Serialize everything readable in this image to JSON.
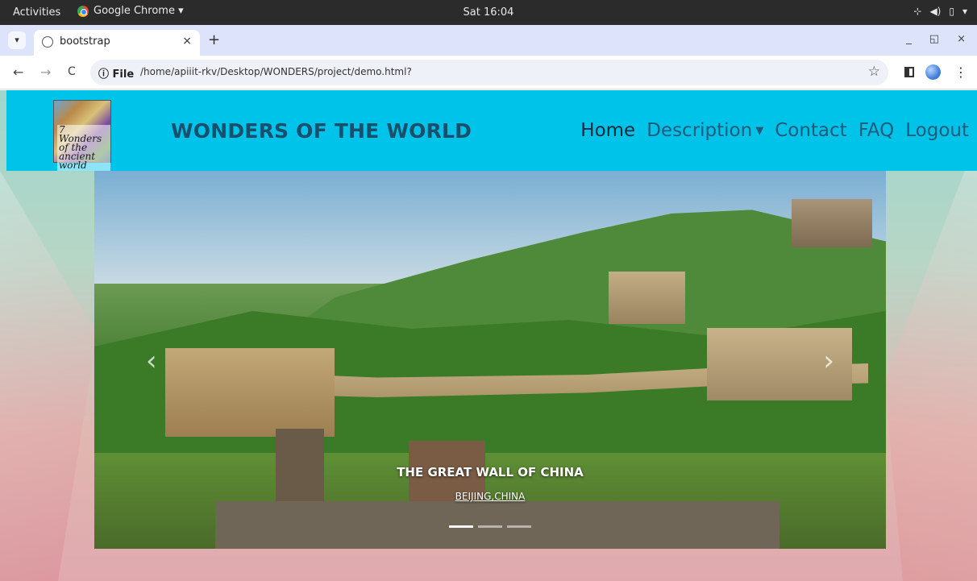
{
  "system_bar": {
    "activities_label": "Activities",
    "app_name": "Google Chrome ▾",
    "clock": "Sat 16:04",
    "tray_icons": [
      "network-icon",
      "volume-icon",
      "battery-icon",
      "system-menu-chevron-icon"
    ]
  },
  "browser": {
    "tab_list_icon": "chevron-down-icon",
    "tab": {
      "title": "bootstrap",
      "favicon": "globe-icon",
      "close_label": "×"
    },
    "new_tab_label": "+",
    "window_controls": {
      "minimize": "_",
      "restore": "◱",
      "close": "×"
    },
    "toolbar": {
      "back_label": "←",
      "forward_label": "→",
      "reload_label": "C",
      "site_info_label": "ⓘ File",
      "url": "/home/apiiit-rkv/Desktop/WONDERS/project/demo.html?",
      "bookmark_label": "☆",
      "menu_label": "⋮"
    }
  },
  "page": {
    "navbar_color": "#00c3ea",
    "logo_text": "7 Wonders of the ancient world",
    "brand": "WONDERS OF THE WORLD",
    "nav_links": [
      {
        "label": "Home",
        "active": true
      },
      {
        "label": "Description",
        "dropdown": true
      },
      {
        "label": "Contact"
      },
      {
        "label": "FAQ"
      },
      {
        "label": "Logout"
      }
    ],
    "dropdown_caret": "▼",
    "carousel": {
      "prev_label": "‹",
      "next_label": "›",
      "caption_title": "THE GREAT WALL OF CHINA",
      "caption_subtitle": "BEIJING,CHINA",
      "slide_count": 3,
      "active_slide": 1
    }
  }
}
